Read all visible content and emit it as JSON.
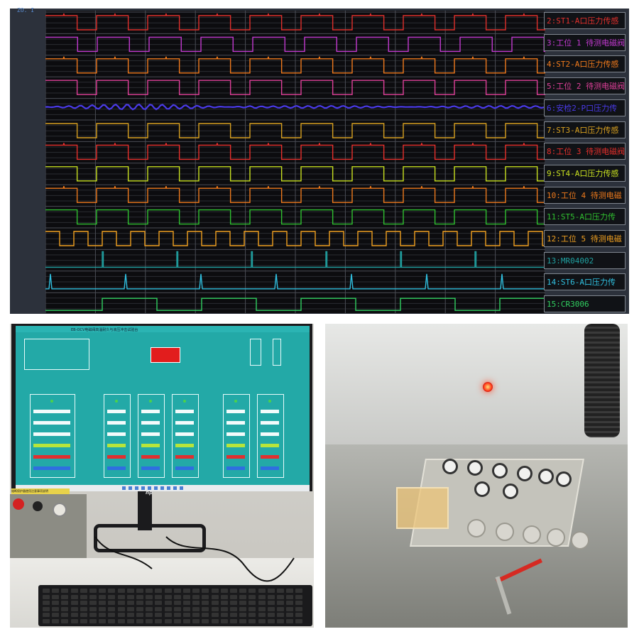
{
  "monitor": {
    "corner_label": "ZO. I",
    "channels": [
      {
        "label": "2:ST1-A口压力传感",
        "color": "#e0302c"
      },
      {
        "label": "3:工位 1 待测电磁阀",
        "color": "#c23ad0"
      },
      {
        "label": "4:ST2-A口压力传感",
        "color": "#f07a1c"
      },
      {
        "label": "5:工位 2 待测电磁阀",
        "color": "#e0409a"
      },
      {
        "label": "6:安检2-P口压力传",
        "color": "#4a3ae8"
      },
      {
        "label": "7:ST3-A口压力传感",
        "color": "#d8a020"
      },
      {
        "label": "8:工位 3 待测电磁阀",
        "color": "#e8302c"
      },
      {
        "label": "9:ST4-A口压力传感",
        "color": "#c8e020"
      },
      {
        "label": "10:工位 4 待测电磁",
        "color": "#ee7a1c"
      },
      {
        "label": "11:ST5-A口压力传",
        "color": "#30c030"
      },
      {
        "label": "12:工位 5 待测电磁",
        "color": "#f0a020"
      },
      {
        "label": "13:MR04002",
        "color": "#20a0a0"
      },
      {
        "label": "14:ST6-A口压力传",
        "color": "#30c0e0"
      },
      {
        "label": "15:CR3006",
        "color": "#30d060"
      }
    ]
  },
  "pc_photo": {
    "screen_title": "EB-OCV电磁阀高温耐久与液压冲击试验台",
    "warning_label": "熔断保护器使用注意事项说明"
  }
}
